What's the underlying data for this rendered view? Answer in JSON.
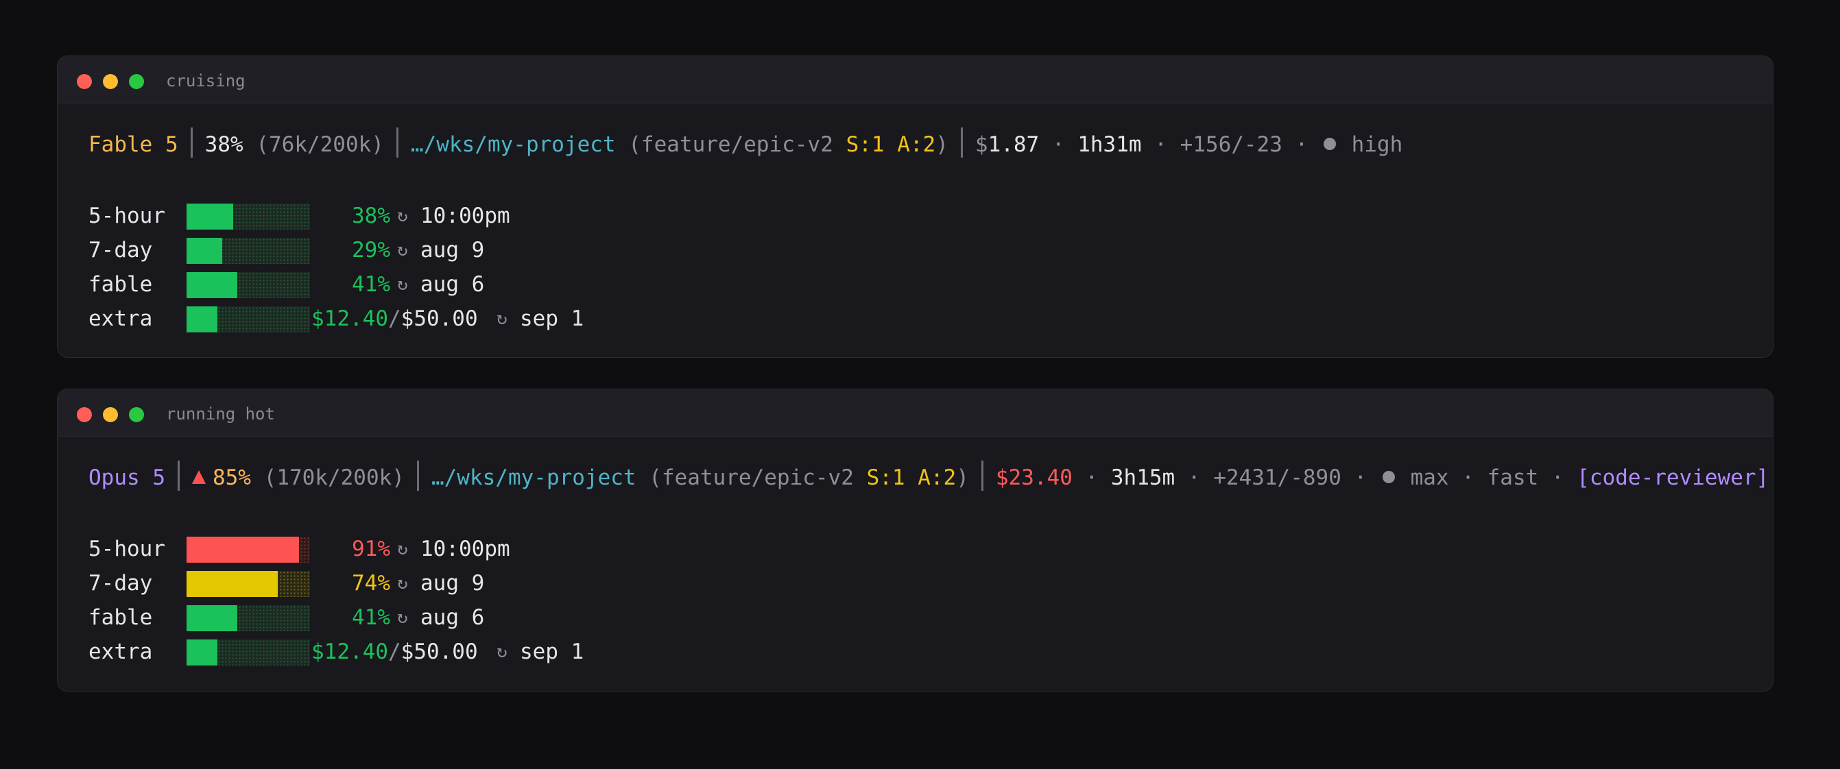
{
  "windows": [
    {
      "title": "cruising",
      "status": {
        "model": "Fable 5",
        "context_pct": "38%",
        "context_tokens": "(76k/200k)",
        "path": "…/wks/my-project",
        "branch_open": "(feature/epic-v2",
        "sessions": "S:1 A:2",
        "branch_close": ")",
        "cost_symbol": "$",
        "cost_value": "1.87",
        "duration": "1h31m",
        "diff": "+156/-23",
        "effort": "high",
        "separator_dot": "·"
      },
      "limits": [
        {
          "label": "5-hour",
          "percent": 38,
          "value": "38%",
          "reset": "10:00pm",
          "color": "#1bc15a"
        },
        {
          "label": "7-day",
          "percent": 29,
          "value": "29%",
          "reset": "aug 9",
          "color": "#1bc15a"
        },
        {
          "label": "fable",
          "percent": 41,
          "value": "41%",
          "reset": "aug 6",
          "color": "#1bc15a"
        },
        {
          "label": "extra",
          "percent": 24.8,
          "spent": "$12.40",
          "slash": "/",
          "cap": "$50.00",
          "reset": "sep 1",
          "color": "#1bc15a"
        }
      ]
    },
    {
      "title": "running hot",
      "status": {
        "model": "Opus 5",
        "context_pct": "85%",
        "context_tokens": "(170k/200k)",
        "path": "…/wks/my-project",
        "branch_open": "(feature/epic-v2",
        "sessions": "S:1 A:2",
        "branch_close": ")",
        "cost": "$23.40",
        "duration": "3h15m",
        "diff": "+2431/-890",
        "effort": "max",
        "speed": "fast",
        "agent": "[code-reviewer]",
        "separator_dot": "·"
      },
      "limits": [
        {
          "label": "5-hour",
          "percent": 91,
          "value": "91%",
          "reset": "10:00pm",
          "color": "#ff5252"
        },
        {
          "label": "7-day",
          "percent": 74,
          "value": "74%",
          "reset": "aug 9",
          "color": "#e3c700"
        },
        {
          "label": "fable",
          "percent": 41,
          "value": "41%",
          "reset": "aug 6",
          "color": "#1bc15a"
        },
        {
          "label": "extra",
          "percent": 24.8,
          "spent": "$12.40",
          "slash": "/",
          "cap": "$50.00",
          "reset": "sep 1",
          "color": "#1bc15a"
        }
      ]
    }
  ],
  "icons": {
    "clock": "clock-icon",
    "warning": "warning-icon",
    "effort_dot": "effort-dot-icon"
  },
  "clock_glyph": "↻"
}
